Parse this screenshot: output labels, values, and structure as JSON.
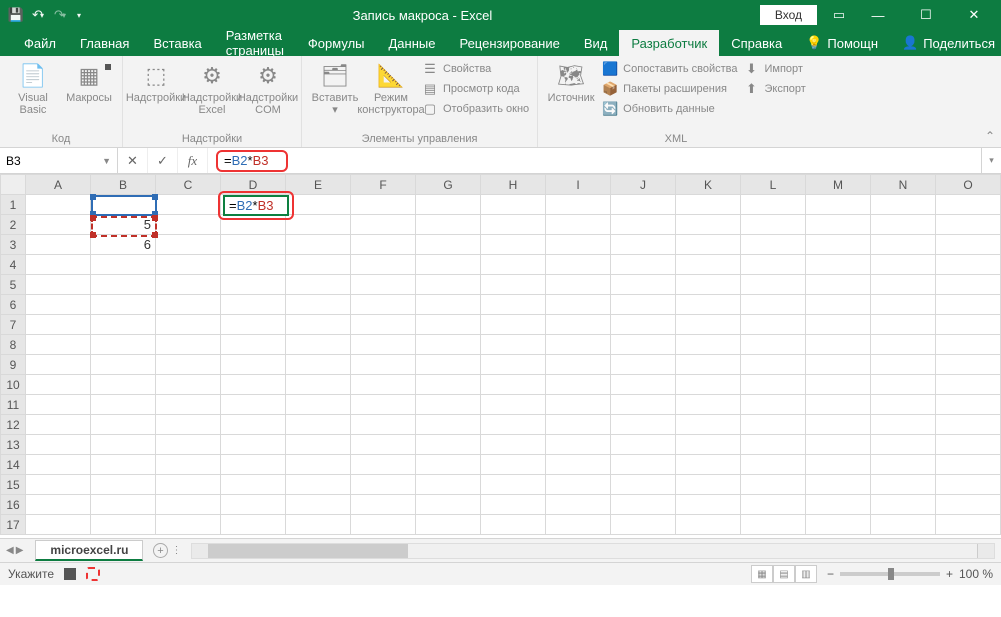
{
  "title": "Запись макроса - Excel",
  "signin": "Вход",
  "menu": [
    "Файл",
    "Главная",
    "Вставка",
    "Разметка страницы",
    "Формулы",
    "Данные",
    "Рецензирование",
    "Вид",
    "Разработчик",
    "Справка"
  ],
  "menu_active": "Разработчик",
  "menu_right": {
    "tell": "Помощн",
    "share": "Поделиться"
  },
  "ribbon": {
    "groups": [
      "Код",
      "Надстройки",
      "Элементы управления",
      "XML"
    ],
    "code": {
      "vb": "Visual\nBasic",
      "macros": "Макросы"
    },
    "addins": {
      "addins": "Надстройки",
      "excel": "Надстройки\nExcel",
      "com": "Надстройки\nCOM"
    },
    "controls": {
      "insert": "Вставить",
      "design": "Режим\nконструктора",
      "props": "Свойства",
      "viewcode": "Просмотр кода",
      "showwin": "Отобразить окно"
    },
    "xml": {
      "source": "Источник",
      "mapprops": "Сопоставить свойства",
      "expansion": "Пакеты расширения",
      "refresh": "Обновить данные",
      "import": "Импорт",
      "export": "Экспорт"
    }
  },
  "namebox": "B3",
  "formula": {
    "eq": "=",
    "ref1": "B2",
    "op": "*",
    "ref2": "B3"
  },
  "columns": [
    "A",
    "B",
    "C",
    "D",
    "E",
    "F",
    "G",
    "H",
    "I",
    "J",
    "K",
    "L",
    "M",
    "N",
    "O"
  ],
  "rows": 17,
  "cells": {
    "B2": "5",
    "B3": "6"
  },
  "editing_cell": "D2",
  "sheet": "microexcel.ru",
  "status": "Укажите",
  "zoom": "100 %"
}
